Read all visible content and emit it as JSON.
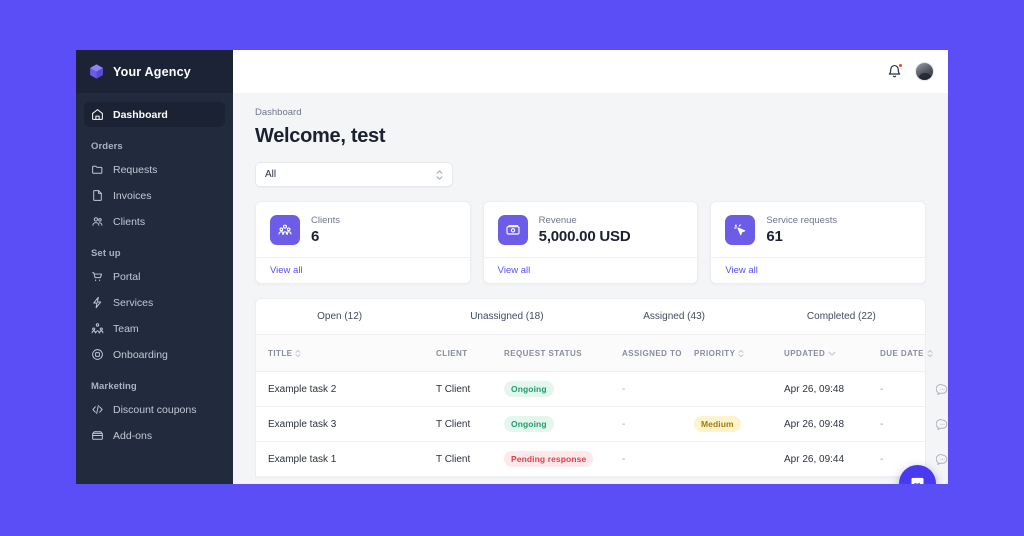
{
  "theme": {
    "page_background": "#5b4ef7",
    "sidebar_background": "#222b3e",
    "accent": "#5b4ef7",
    "card_icon": "#6c5ce7"
  },
  "sidebar": {
    "brand": {
      "name": "Your Agency",
      "logo_icon": "cube-logo-icon"
    },
    "items": [
      {
        "label": "Dashboard",
        "icon": "home-icon",
        "active": true
      },
      {
        "group": "Orders"
      },
      {
        "label": "Requests",
        "icon": "folder-icon",
        "active": false
      },
      {
        "label": "Invoices",
        "icon": "document-icon",
        "active": false
      },
      {
        "label": "Clients",
        "icon": "users-icon",
        "active": false
      },
      {
        "group": "Set up"
      },
      {
        "label": "Portal",
        "icon": "cart-icon",
        "active": false
      },
      {
        "label": "Services",
        "icon": "bolt-icon",
        "active": false
      },
      {
        "label": "Team",
        "icon": "team-icon",
        "active": false
      },
      {
        "label": "Onboarding",
        "icon": "onboarding-icon",
        "active": false
      },
      {
        "group": "Marketing"
      },
      {
        "label": "Discount coupons",
        "icon": "code-icon",
        "active": false
      },
      {
        "label": "Add-ons",
        "icon": "box-icon",
        "active": false
      }
    ]
  },
  "topbar": {
    "notification_icon": "bell-icon",
    "has_notification_dot": true,
    "avatar_icon": "user-avatar"
  },
  "header": {
    "breadcrumb": "Dashboard",
    "title": "Welcome, test"
  },
  "filter": {
    "value": "All",
    "chevron_icon": "chevron-updown-icon"
  },
  "cards": [
    {
      "label": "Clients",
      "value": "6",
      "icon": "clients-icon",
      "link": "View all"
    },
    {
      "label": "Revenue",
      "value": "5,000.00 USD",
      "icon": "money-icon",
      "link": "View all"
    },
    {
      "label": "Service requests",
      "value": "61",
      "icon": "cursor-click-icon",
      "link": "View all"
    }
  ],
  "tabs": [
    {
      "label": "Open (12)",
      "active": false
    },
    {
      "label": "Unassigned (18)",
      "active": false
    },
    {
      "label": "Assigned (43)",
      "active": false
    },
    {
      "label": "Completed (22)",
      "active": false
    }
  ],
  "table": {
    "columns": [
      {
        "label": "Title",
        "sort": "updown"
      },
      {
        "label": "Client",
        "sort": null
      },
      {
        "label": "Request status",
        "sort": null
      },
      {
        "label": "Assigned to",
        "sort": null
      },
      {
        "label": "Priority",
        "sort": "updown"
      },
      {
        "label": "Updated",
        "sort": "down"
      },
      {
        "label": "Due date",
        "sort": "updown"
      }
    ],
    "rows": [
      {
        "title": "Example task 2",
        "client": "T Client",
        "status": "Ongoing",
        "status_tone": "green",
        "assigned_to": "-",
        "priority": "",
        "priority_tone": "",
        "updated": "Apr 26, 09:48",
        "due_date": "-",
        "action_icon": "comment-icon"
      },
      {
        "title": "Example task 3",
        "client": "T Client",
        "status": "Ongoing",
        "status_tone": "green",
        "assigned_to": "-",
        "priority": "Medium",
        "priority_tone": "yellow",
        "updated": "Apr 26, 09:48",
        "due_date": "-",
        "action_icon": "comment-icon"
      },
      {
        "title": "Example task 1",
        "client": "T Client",
        "status": "Pending response",
        "status_tone": "red",
        "assigned_to": "-",
        "priority": "",
        "priority_tone": "",
        "updated": "Apr 26, 09:44",
        "due_date": "-",
        "action_icon": "comment-icon"
      }
    ]
  },
  "chat_widget": {
    "icon": "chat-bubble-icon"
  }
}
